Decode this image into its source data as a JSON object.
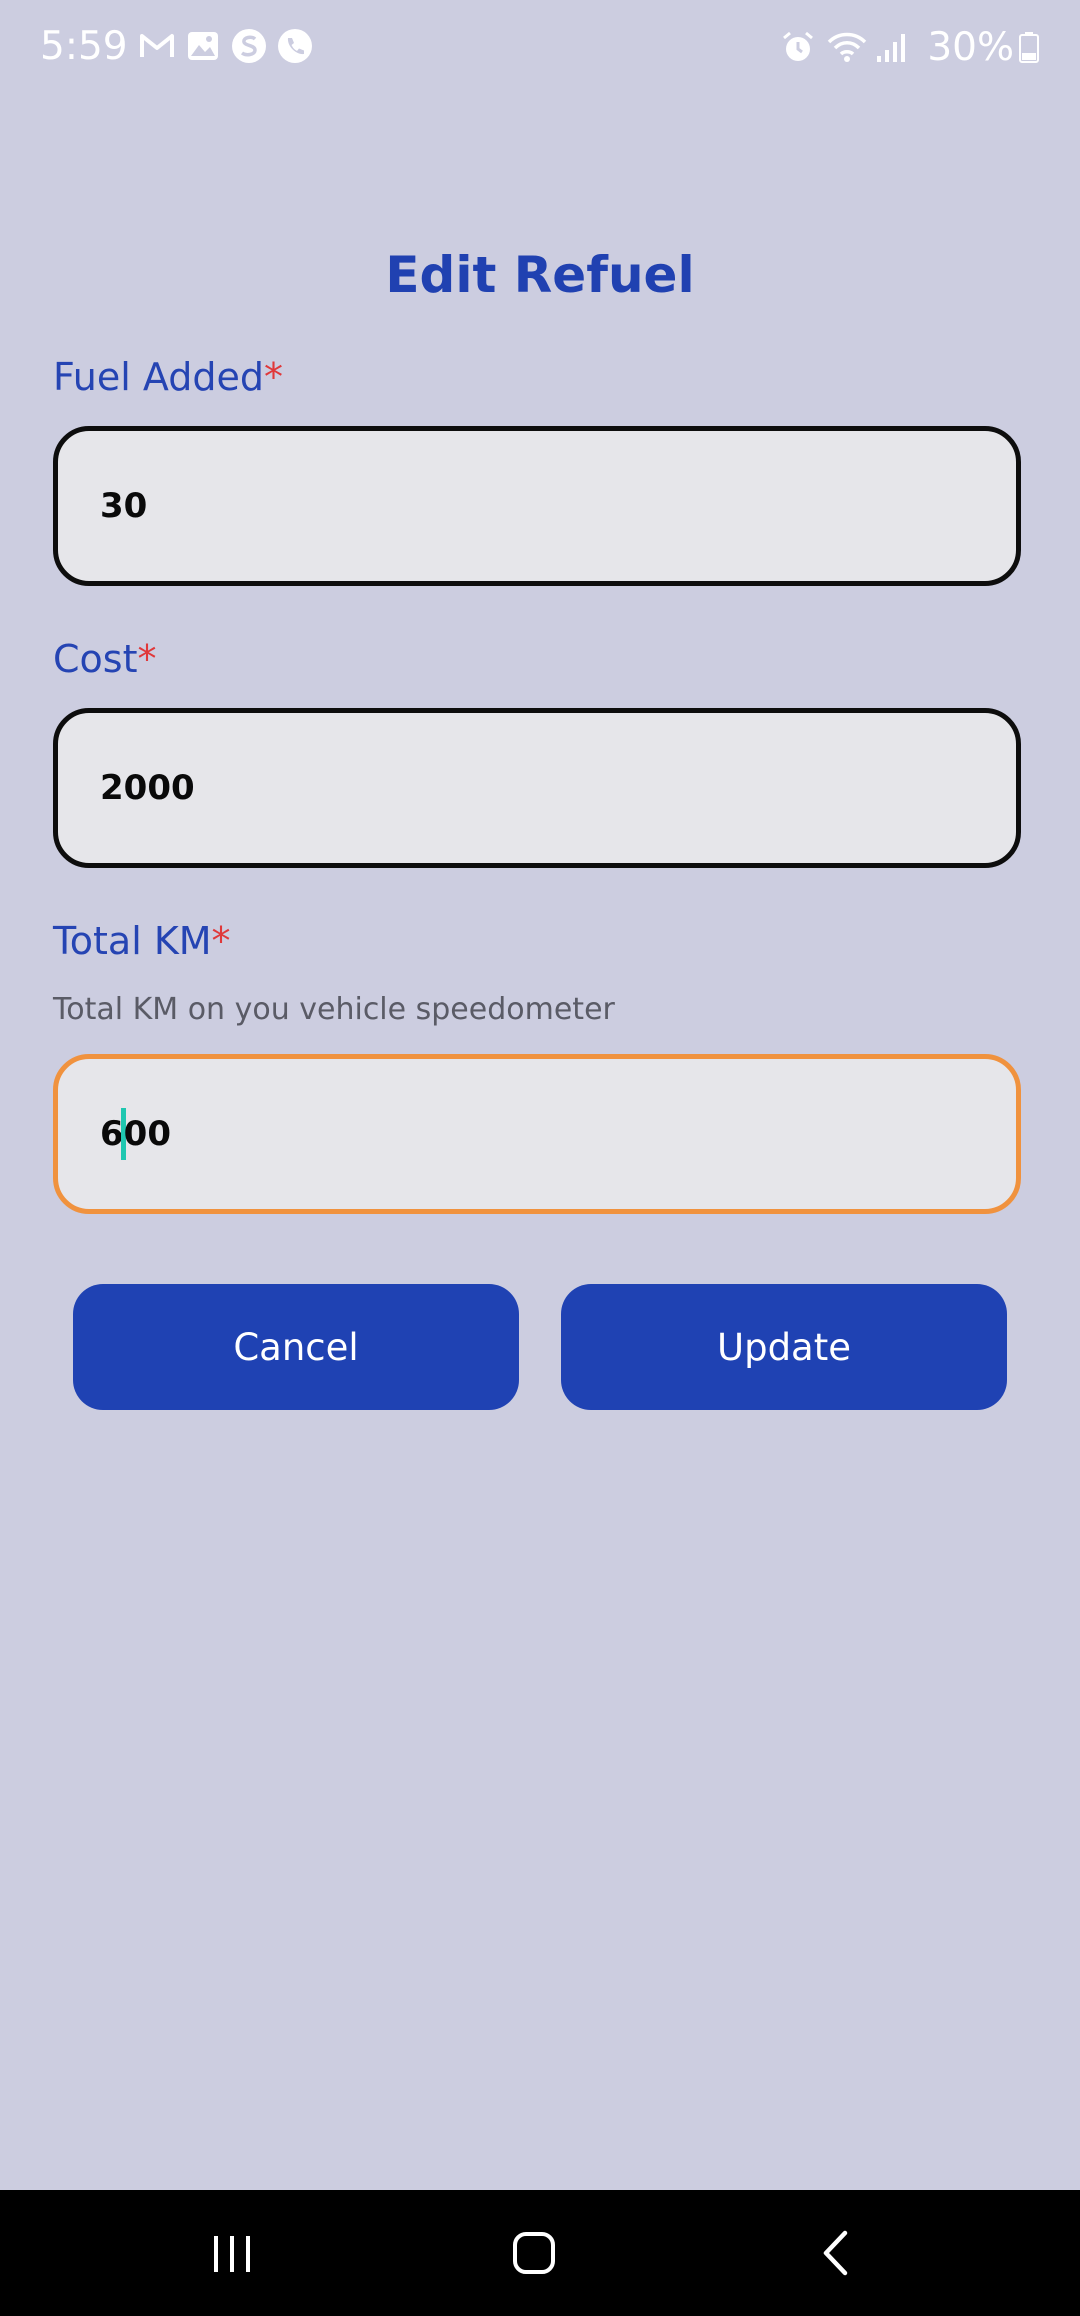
{
  "status_bar": {
    "time": "5:59",
    "battery": "30%",
    "left_icons": [
      "gmail-icon",
      "gallery-icon",
      "app-s-icon",
      "phone-app-icon"
    ],
    "right_icons": [
      "alarm-icon",
      "wifi-icon",
      "signal-icon",
      "battery-icon"
    ]
  },
  "page": {
    "title": "Edit Refuel"
  },
  "form": {
    "fuel_added": {
      "label": "Fuel Added",
      "required_mark": "*",
      "value": "30"
    },
    "cost": {
      "label": "Cost",
      "required_mark": "*",
      "value": "2000"
    },
    "total_km": {
      "label": "Total KM",
      "required_mark": "*",
      "help": "Total KM on you vehicle speedometer",
      "value_before_caret": "6",
      "value_after_caret": "00"
    }
  },
  "actions": {
    "cancel_label": "Cancel",
    "update_label": "Update"
  },
  "nav_bar": {
    "icons": [
      "recents-icon",
      "home-icon",
      "back-icon"
    ]
  },
  "colors": {
    "background": "#cccde0",
    "accent": "#1f42b3",
    "label": "#2544b3",
    "required": "#e0383a",
    "focus_border": "#f0923e",
    "caret": "#1fc7b0"
  }
}
